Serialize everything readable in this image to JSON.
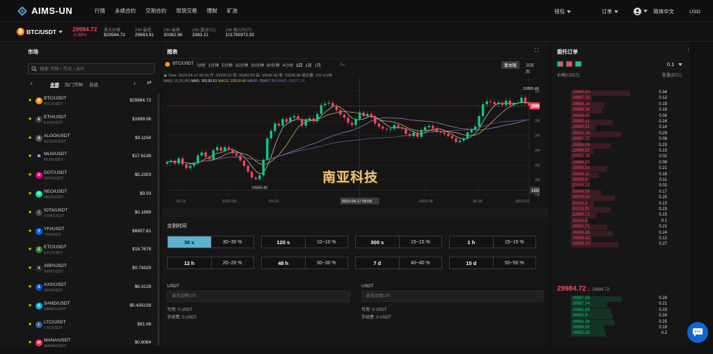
{
  "brand": {
    "name": "AIMS-UN",
    "accent": "#4fa3c7"
  },
  "nav": {
    "items": [
      "行情",
      "永续合约",
      "交割合约",
      "现货交易",
      "理财",
      "矿池"
    ],
    "wallet": "钱包",
    "orders": "订单",
    "language": "简体中文",
    "currency": "USD"
  },
  "ticker": {
    "pair": "BTC/USDT",
    "last_price": "29984.72",
    "change": "-0.88%",
    "stats": [
      {
        "label": "美元价格",
        "value": "$29984.72"
      },
      {
        "label": "24h 最低",
        "value": "29683.91"
      },
      {
        "label": "24h 最高",
        "value": "30362.96"
      },
      {
        "label": "24h 量(BTC)",
        "value": "3383.21"
      },
      {
        "label": "24h 额(USDT)",
        "value": "101780972.92"
      }
    ]
  },
  "market": {
    "title": "市场",
    "search_placeholder": "搜索 币种 / 币对 / 合约",
    "tabs": [
      "全部",
      "热门币种",
      "自选"
    ],
    "rows": [
      {
        "name": "BTC/USDT",
        "sub": "BTC/USDT",
        "price": "$29984.72",
        "change": "-0.88%",
        "dir": "dn",
        "icon": "B",
        "color": "#f7931a"
      },
      {
        "name": "ETH/USDT",
        "sub": "ETH/USDT",
        "price": "$1899.08",
        "change": "-1.48%",
        "dir": "dn",
        "icon": "E",
        "color": "#3c3c3d"
      },
      {
        "name": "ALGO/USDT",
        "sub": "ALGO/USDT",
        "price": "$0.1154",
        "change": "+0.35%",
        "dir": "up",
        "icon": "A",
        "color": "#555555"
      },
      {
        "name": "MLN/USDT",
        "sub": "MLN/USDT",
        "price": "$17.6139",
        "change": "-1.65%",
        "dir": "dn",
        "icon": "M",
        "color": "#0b1529"
      },
      {
        "name": "DOT/USDT",
        "sub": "DOT/USDT",
        "price": "$5.2303",
        "change": "-1.52%",
        "dir": "dn",
        "icon": "D",
        "color": "#e6007a"
      },
      {
        "name": "NEO/USDT",
        "sub": "NEO/USDT",
        "price": "$9.03",
        "change": "-1.2%",
        "dir": "dn",
        "icon": "N",
        "color": "#00e599"
      },
      {
        "name": "IOTA/USDT",
        "sub": "IOTA/USDT",
        "price": "$0.1889",
        "change": "+0.27%",
        "dir": "up",
        "icon": "I",
        "color": "#444444"
      },
      {
        "name": "YFI/USDT",
        "sub": "YFI/USDT",
        "price": "$6907.81",
        "change": "-1.15%",
        "dir": "dn",
        "icon": "Y",
        "color": "#006ae3"
      },
      {
        "name": "ETC/USDT",
        "sub": "ETC/USDT",
        "price": "$18.7678",
        "change": "-0.57%",
        "dir": "dn",
        "icon": "E",
        "color": "#328332"
      },
      {
        "name": "XRP/USDT",
        "sub": "XRP/USDT",
        "price": "$0.74329",
        "change": "+0.24%",
        "dir": "up",
        "icon": "X",
        "color": "#23292f"
      },
      {
        "name": "AXS/USDT",
        "sub": "AXS/USDT",
        "price": "$6.3129",
        "change": "+1.07%",
        "dir": "up",
        "icon": "A",
        "color": "#0055d5"
      },
      {
        "name": "SAND/USDT",
        "sub": "SAND/USDT",
        "price": "$0.435108",
        "change": "+0.13%",
        "dir": "up",
        "icon": "S",
        "color": "#00adef"
      },
      {
        "name": "LTC/USDT",
        "sub": "LTC/USDT",
        "price": "$91.06",
        "change": "-2.84%",
        "dir": "dn",
        "icon": "L",
        "color": "#345d9d"
      },
      {
        "name": "MANA/USDT",
        "sub": "MANA/USDT",
        "price": "$0.6084",
        "change": "-0.12%",
        "dir": "dn",
        "icon": "M",
        "color": "#ff2d55"
      }
    ]
  },
  "chart": {
    "title": "图表",
    "pair": "BTC/USDT",
    "intervals": [
      "分时",
      "1分钟",
      "5分钟",
      "15分钟",
      "30分钟",
      "60分钟",
      "4小时",
      "1日",
      "1周",
      "1月"
    ],
    "active_interval": "1日",
    "view_basic": "基本版",
    "view_depth": "深度图",
    "ohlc_line": "Time: 2023-04-17 00:00  开: 30335.52  低: 29356.83  高: 30540.00  收: 29235.94  成交量: 102.410M",
    "ma_line": {
      "label": "MA(5,10,30,60)",
      "ma5": "MA5: 30139.51",
      "ma10": "MA10: 29518.40",
      "ma30": "MA30: 28497.33",
      "ma60": "MA60: 25977.24"
    },
    "watermark": "南亚科技",
    "hover_time": "2023-04-17 00:00",
    "hover_price": "18504.44",
    "current_price": "29984.72",
    "high_label": "31800.46",
    "low_label": "19558.40"
  },
  "chart_data": {
    "type": "line",
    "title": "",
    "xlabel": "",
    "ylabel": "",
    "x_ticks": [
      "02-11",
      "2023-03",
      "03-23",
      "2023-05",
      "2023-06",
      "06-26",
      "2023-07"
    ],
    "y_ticks": [
      "32000.00",
      "30000.00",
      "28000.00",
      "26000.00",
      "24000.00",
      "22000.00",
      "20000.00",
      "18000.00"
    ],
    "ylim": [
      17800,
      33200
    ],
    "series": [
      {
        "values": [
          22400,
          22600,
          22200,
          22900,
          22100,
          21600,
          21900,
          22300,
          23300,
          23700,
          23100,
          22800,
          24000,
          24400,
          23900,
          24400,
          24100,
          23600,
          23300,
          22600,
          21900,
          21100,
          20300,
          20100,
          20600,
          22700,
          25600,
          26600,
          27600,
          27300,
          28200,
          27800,
          28400,
          28600,
          28200,
          27300,
          28100,
          28300,
          27900,
          28900,
          30100,
          30300,
          30400,
          29900,
          29400,
          28800,
          28400,
          27700,
          27400,
          28200,
          29100,
          28600,
          28900,
          28500,
          27600,
          27200,
          26900,
          26800,
          26900,
          27400,
          27100,
          26900,
          26200,
          25900,
          26400,
          25800,
          26700,
          27100,
          27300,
          26900,
          26600,
          26400,
          26200,
          25900,
          25600,
          25100,
          25300,
          25600,
          26400,
          26800,
          27200,
          28600,
          30200,
          30600,
          30500,
          30200,
          30400,
          30100,
          30700,
          30100,
          30300,
          30400,
          31100,
          30300,
          29984
        ]
      }
    ]
  },
  "trade": {
    "title": "交割时间",
    "options": [
      {
        "time": "30 s",
        "rate": "30~30 %",
        "selected": true
      },
      {
        "time": "120 s",
        "rate": "10~10 %"
      },
      {
        "time": "300 s",
        "rate": "15~15 %"
      },
      {
        "time": "1 h",
        "rate": "15~15 %"
      },
      {
        "time": "12 h",
        "rate": "20~20 %"
      },
      {
        "time": "48 h",
        "rate": "30~30 %"
      },
      {
        "time": "7 d",
        "rate": "40~40 %"
      },
      {
        "time": "15 d",
        "rate": "50~50 %"
      }
    ],
    "left": {
      "unit": "USDT",
      "placeholder": "最低金额100",
      "available": "可用: 0 USDT",
      "fee": "手续费: 0 USDT"
    },
    "right": {
      "unit": "USDT",
      "placeholder": "最低金额100",
      "available": "可用: 0 USDT",
      "fee": "手续费: 0 USDT"
    }
  },
  "orderbook": {
    "title": "委托订单",
    "precision": "0.1",
    "col_price": "价格(USDT)",
    "col_amount": "数量(BTC)",
    "mid_price": "29984.72",
    "mid_sub": "29984.72",
    "asks": [
      {
        "p": "29985.83",
        "q": "0.34"
      },
      {
        "p": "29987.32",
        "q": "0.12"
      },
      {
        "p": "29988.14",
        "q": "0.19"
      },
      {
        "p": "29988.98",
        "q": "0.18"
      },
      {
        "p": "29989.89",
        "q": "0.08"
      },
      {
        "p": "29990.11",
        "q": "0.24"
      },
      {
        "p": "29990.51",
        "q": "0.14"
      },
      {
        "p": "29991.19",
        "q": "0.29"
      },
      {
        "p": "29993.32",
        "q": "0.06"
      },
      {
        "p": "29989.09",
        "q": "0.23"
      },
      {
        "p": "29998.97",
        "q": "0.13"
      },
      {
        "p": "29992.39",
        "q": "0.02"
      },
      {
        "p": "29989.39",
        "q": "0.09"
      },
      {
        "p": "29990.53",
        "q": "0.21"
      },
      {
        "p": "29994.11",
        "q": "0.16"
      },
      {
        "p": "30009.9",
        "q": "0.11"
      },
      {
        "p": "29988.33",
        "q": "0.02"
      },
      {
        "p": "30006.55",
        "q": "0.17"
      },
      {
        "p": "30019.54",
        "q": "0.25"
      },
      {
        "p": "30015.2",
        "q": "0.13"
      },
      {
        "p": "30028.91",
        "q": "0.23"
      },
      {
        "p": "29995.72",
        "q": "0.15"
      },
      {
        "p": "30016.8",
        "q": "0.1"
      },
      {
        "p": "29992.71",
        "q": "0.21"
      },
      {
        "p": "29998.26",
        "q": "0.24"
      },
      {
        "p": "29993.42",
        "q": "0.12"
      },
      {
        "p": "29995.43",
        "q": "0.27"
      }
    ],
    "bids": [
      {
        "p": "29987.59",
        "q": "0.29"
      },
      {
        "p": "29987.74",
        "q": "0.21"
      },
      {
        "p": "29991.83",
        "q": "0.23"
      },
      {
        "p": "29990.9",
        "q": "0.24"
      },
      {
        "p": "29981.36",
        "q": "0.25"
      },
      {
        "p": "29998.92",
        "q": "0.19"
      },
      {
        "p": "29992.65",
        "q": "0.2"
      }
    ]
  }
}
